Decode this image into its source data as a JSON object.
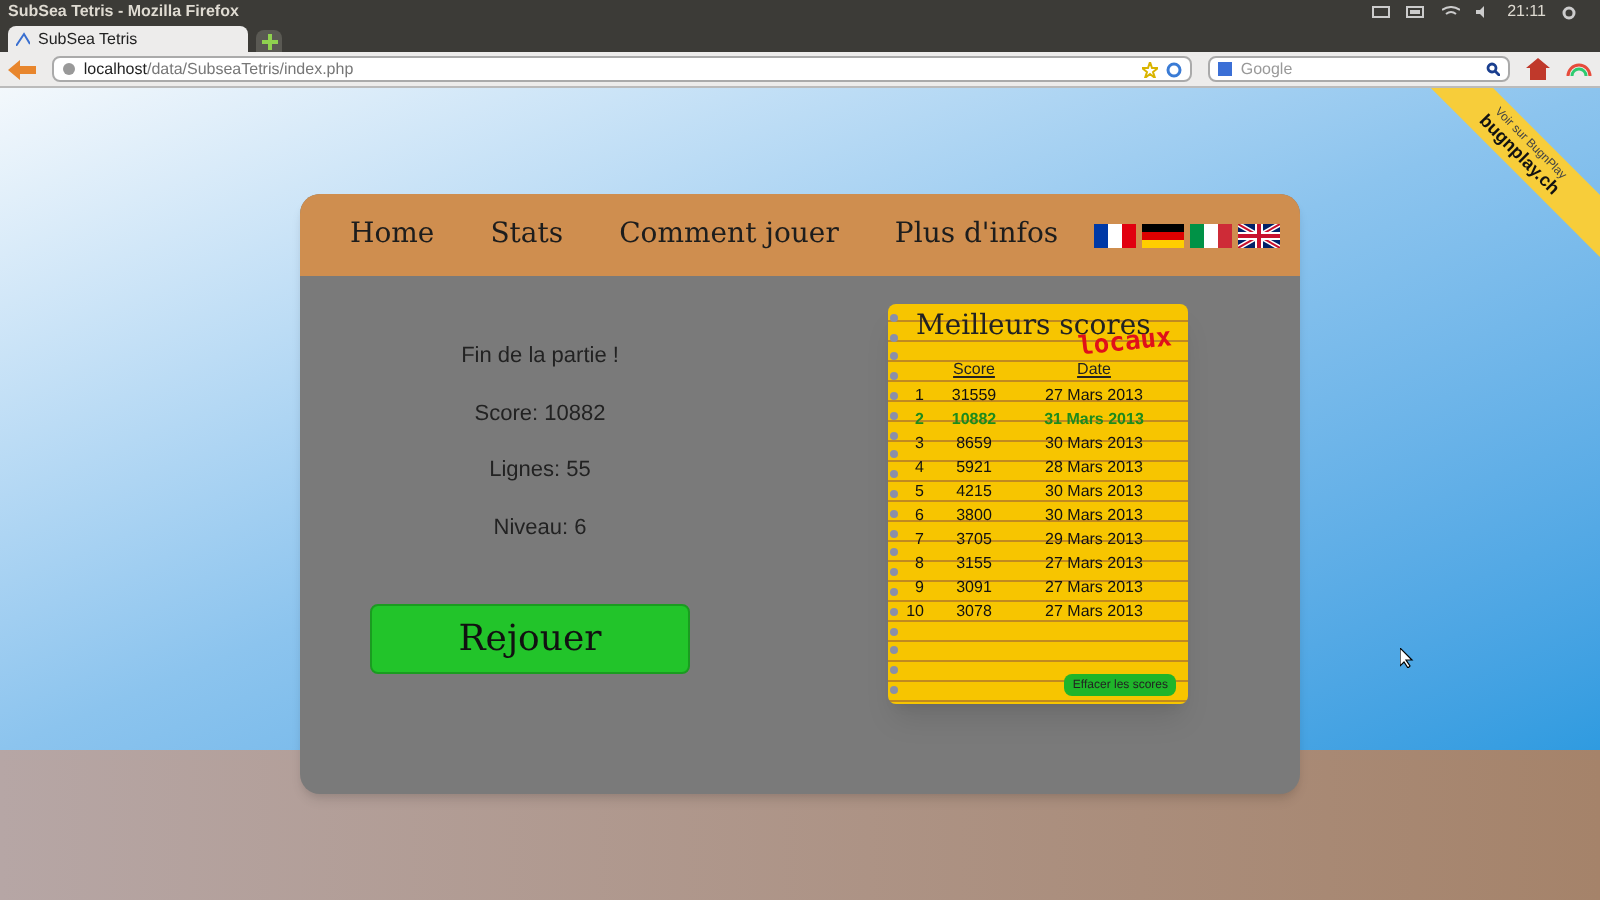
{
  "window": {
    "title": "SubSea Tetris - Mozilla Firefox"
  },
  "system_tray": {
    "time": "21:11"
  },
  "tabs": [
    {
      "label": "SubSea Tetris",
      "selected": true
    }
  ],
  "address_bar": {
    "host": "localhost",
    "path": "/data/SubseaTetris/index.php"
  },
  "search": {
    "placeholder": "Google"
  },
  "ribbon": {
    "caption": "Voir sur BugnPlay",
    "site": "bugnplay.ch"
  },
  "nav": [
    {
      "label": "Home"
    },
    {
      "label": "Stats"
    },
    {
      "label": "Comment jouer"
    },
    {
      "label": "Plus d'infos"
    }
  ],
  "languages": [
    {
      "kind": "fr"
    },
    {
      "kind": "de"
    },
    {
      "kind": "it"
    },
    {
      "kind": "uk"
    }
  ],
  "game_over": {
    "title": "Fin de la partie !",
    "score": "Score: 10882",
    "lines": "Lignes: 55",
    "level": "Niveau: 6",
    "button": "Rejouer"
  },
  "high_scores": {
    "title": "Meilleurs scores",
    "subtitle": "locaux",
    "columns": [
      "Score",
      "Date"
    ],
    "rows": [
      {
        "rank": "1",
        "score": "31559",
        "date": "27 Mars 2013",
        "selected": false
      },
      {
        "rank": "2",
        "score": "10882",
        "date": "31 Mars 2013",
        "selected": true
      },
      {
        "rank": "3",
        "score": "8659",
        "date": "30 Mars 2013",
        "selected": false
      },
      {
        "rank": "4",
        "score": "5921",
        "date": "28 Mars 2013",
        "selected": false
      },
      {
        "rank": "5",
        "score": "4215",
        "date": "30 Mars 2013",
        "selected": false
      },
      {
        "rank": "6",
        "score": "3800",
        "date": "30 Mars 2013",
        "selected": false
      },
      {
        "rank": "7",
        "score": "3705",
        "date": "29 Mars 2013",
        "selected": false
      },
      {
        "rank": "8",
        "score": "3155",
        "date": "27 Mars 2013",
        "selected": false
      },
      {
        "rank": "9",
        "score": "3091",
        "date": "27 Mars 2013",
        "selected": false
      },
      {
        "rank": "10",
        "score": "3078",
        "date": "27 Mars 2013",
        "selected": false
      }
    ],
    "clear_button": "Effacer les scores"
  }
}
